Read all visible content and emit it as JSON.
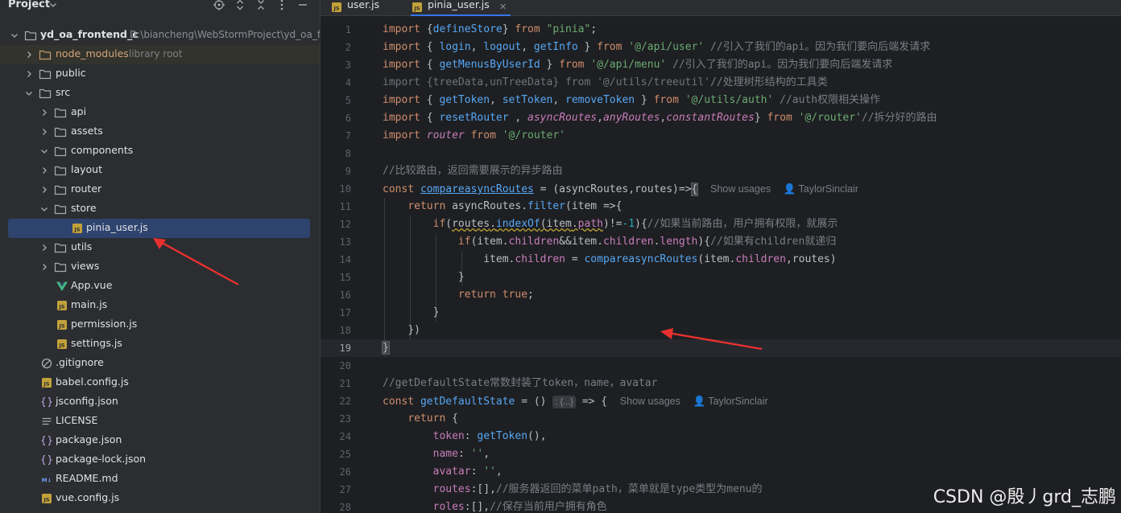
{
  "project_panel": {
    "title": "Project",
    "root": {
      "name": "yd_oa_frontend_c",
      "path": "D:\\biancheng\\WebStormProject\\yd_oa_fr"
    },
    "node_modules": {
      "name": "node_modules",
      "note": "library root"
    },
    "items": {
      "public": "public",
      "src": "src",
      "api": "api",
      "assets": "assets",
      "components": "components",
      "layout": "layout",
      "router": "router",
      "store": "store",
      "pinia_user": "pinia_user.js",
      "utils": "utils",
      "views": "views",
      "app_vue": "App.vue",
      "main_js": "main.js",
      "permission_js": "permission.js",
      "settings_js": "settings.js",
      "gitignore": ".gitignore",
      "babel_config": "babel.config.js",
      "jsconfig": "jsconfig.json",
      "license": "LICENSE",
      "package_json": "package.json",
      "package_lock": "package-lock.json",
      "readme": "README.md",
      "vue_config": "vue.config.js"
    }
  },
  "editor": {
    "tabs": [
      "user.js",
      "pinia_user.js"
    ],
    "active_tab": "pinia_user.js",
    "current_line": 19,
    "line_numbers": [
      "1",
      "2",
      "3",
      "4",
      "5",
      "6",
      "7",
      "8",
      "9",
      "10",
      "11",
      "12",
      "13",
      "14",
      "15",
      "16",
      "17",
      "18",
      "19",
      "20",
      "21",
      "22",
      "23",
      "24",
      "25",
      "26",
      "27",
      "28"
    ],
    "inlay": {
      "usages": "Show usages",
      "author": "TaylorSinclair",
      "params_chip": "{...}"
    },
    "code": {
      "l1_import": "import",
      "l1_name": "defineStore",
      "l1_from": "from",
      "l1_src": "\"pinia\"",
      "l2_names": [
        "login",
        "logout",
        "getInfo"
      ],
      "l2_src": "'@/api/user'",
      "l2_comment": "//引入了我们的api。因为我们要向后端发请求",
      "l3_name": "getMenusByUserId",
      "l3_src": "'@/api/menu'",
      "l3_comment": "//引入了我们的api。因为我们要向后端发请求",
      "l4_text": "import {treeData,unTreeData} from '@/utils/treeutil'",
      "l4_comment": "//处理树形结构的工具类",
      "l5_names": [
        "getToken",
        "setToken",
        "removeToken"
      ],
      "l5_src": "'@/utils/auth'",
      "l5_comment": "//auth权限相关操作",
      "l6_names": [
        "resetRouter",
        "asyncRoutes",
        "anyRoutes",
        "constantRoutes"
      ],
      "l6_src": "'@/router'",
      "l6_comment": "//拆分好的路由",
      "l7_name": "router",
      "l7_src": "'@/router'",
      "l9_comment": "//比较路由，返回需要展示的异步路由",
      "l10_const": "const",
      "l10_fn": "compareasyncRoutes",
      "l10_rest": " = (asyncRoutes,routes)=>",
      "l11_return": "return",
      "l11_obj": "asyncRoutes",
      "l11_method": "filter",
      "l11_rest": "(item =>{",
      "l12_if": "if",
      "l12_text_a": "routes",
      "l12_method": "indexOf",
      "l12_text_b": "item",
      "l12_prop": "path",
      "l12_tail": ")!=",
      "l12_num": "-1",
      "l12_close": "){",
      "l12_comment": "//如果当前路由，用户拥有权限，就展示",
      "l13_if": "if",
      "l13_a": "(item.",
      "l13_prop1": "children",
      "l13_b": "&&item.",
      "l13_prop2": "children",
      "l13_c": ".",
      "l13_prop3": "length",
      "l13_d": "){",
      "l13_comment": "//如果有children就递归",
      "l14_a": "item.",
      "l14_prop": "children",
      "l14_b": " = ",
      "l14_fn": "compareasyncRoutes",
      "l14_c": "(item.",
      "l14_prop2": "children",
      "l14_d": ",routes)",
      "l15": "}",
      "l16_return": "return",
      "l16_true": "true",
      "l16_semi": ";",
      "l17": "}",
      "l18": "})",
      "l19": "}",
      "l21_comment": "//getDefaultState常数封装了token，name，avatar",
      "l22_const": "const",
      "l22_fn": "getDefaultState",
      "l22_eq": " = ()",
      "l22_arrow": " => {",
      "l23_return": "return",
      "l23_brace": " {",
      "l24_key": "token",
      "l24_fn": "getToken",
      "l24_rest": "(),",
      "l25_key": "name",
      "l25_val": "''",
      "l26_key": "avatar",
      "l26_val": "''",
      "l27_key": "routes",
      "l27_val": ":[],",
      "l27_comment": "//服务器返回的菜单path，菜单就是type类型为menu的",
      "l28_key": "roles",
      "l28_val": ":[],",
      "l28_comment": "//保存当前用户拥有角色"
    }
  },
  "watermark": "CSDN @殷丿grd_志鹏",
  "colors": {
    "accent": "#3574f0",
    "arrow": "#e8312f",
    "selection": "#2e436e"
  }
}
